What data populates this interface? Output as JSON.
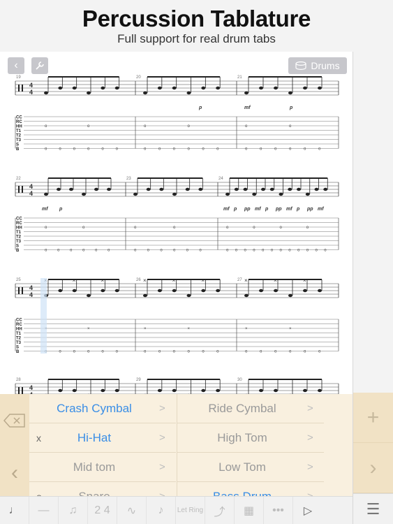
{
  "hero": {
    "title": "Percussion Tablature",
    "subtitle": "Full support for real drum tabs"
  },
  "toolbar_top": {
    "back_icon": "chevron-left-icon",
    "wrench_icon": "wrench-icon",
    "drums_label": "Drums"
  },
  "score": {
    "systems": [
      {
        "measures": [
          "19",
          "20",
          "21"
        ],
        "dynamics": [
          "p",
          "mf",
          "p"
        ]
      },
      {
        "measures": [
          "22",
          "23",
          "24"
        ],
        "dynamics": [
          "mf",
          "p",
          "mf",
          "p",
          "pp",
          "mf",
          "p",
          "pp",
          "mf",
          "p",
          "pp",
          "mf"
        ]
      },
      {
        "measures": [
          "25",
          "26",
          "27"
        ],
        "dynamics": []
      },
      {
        "measures": [
          "28",
          "29",
          "30"
        ],
        "dynamics": []
      }
    ],
    "tab_labels": [
      "CC",
      "RC",
      "HH",
      "T1",
      "T2",
      "T3",
      "S",
      "B"
    ],
    "time_signature": [
      "4",
      "4"
    ]
  },
  "instruments": {
    "left": [
      {
        "label": "Crash Cymbal",
        "mark": "",
        "selected": true
      },
      {
        "label": "Hi-Hat",
        "mark": "x",
        "selected": true
      },
      {
        "label": "Mid tom",
        "mark": "",
        "selected": false
      },
      {
        "label": "Snare",
        "mark": "o",
        "selected": false
      }
    ],
    "right": [
      {
        "label": "Ride Cymbal",
        "mark": "",
        "selected": false
      },
      {
        "label": "High Tom",
        "mark": "",
        "selected": false
      },
      {
        "label": "Low Tom",
        "mark": "",
        "selected": false
      },
      {
        "label": "Bass Drum",
        "mark": "",
        "selected": true
      }
    ],
    "arrow": ">"
  },
  "toolbar": {
    "items": [
      "quarter-note-icon",
      "rest-icon",
      "eighth-note-icon",
      "triplet-icon",
      "tie-icon",
      "grace-icon",
      "let-ring-icon",
      "slide-icon",
      "chord-grid-icon",
      "more-icon",
      "play-icon"
    ],
    "triplet_label": "2 4",
    "let_ring_label": "Let Ring",
    "more_label": "•••"
  }
}
